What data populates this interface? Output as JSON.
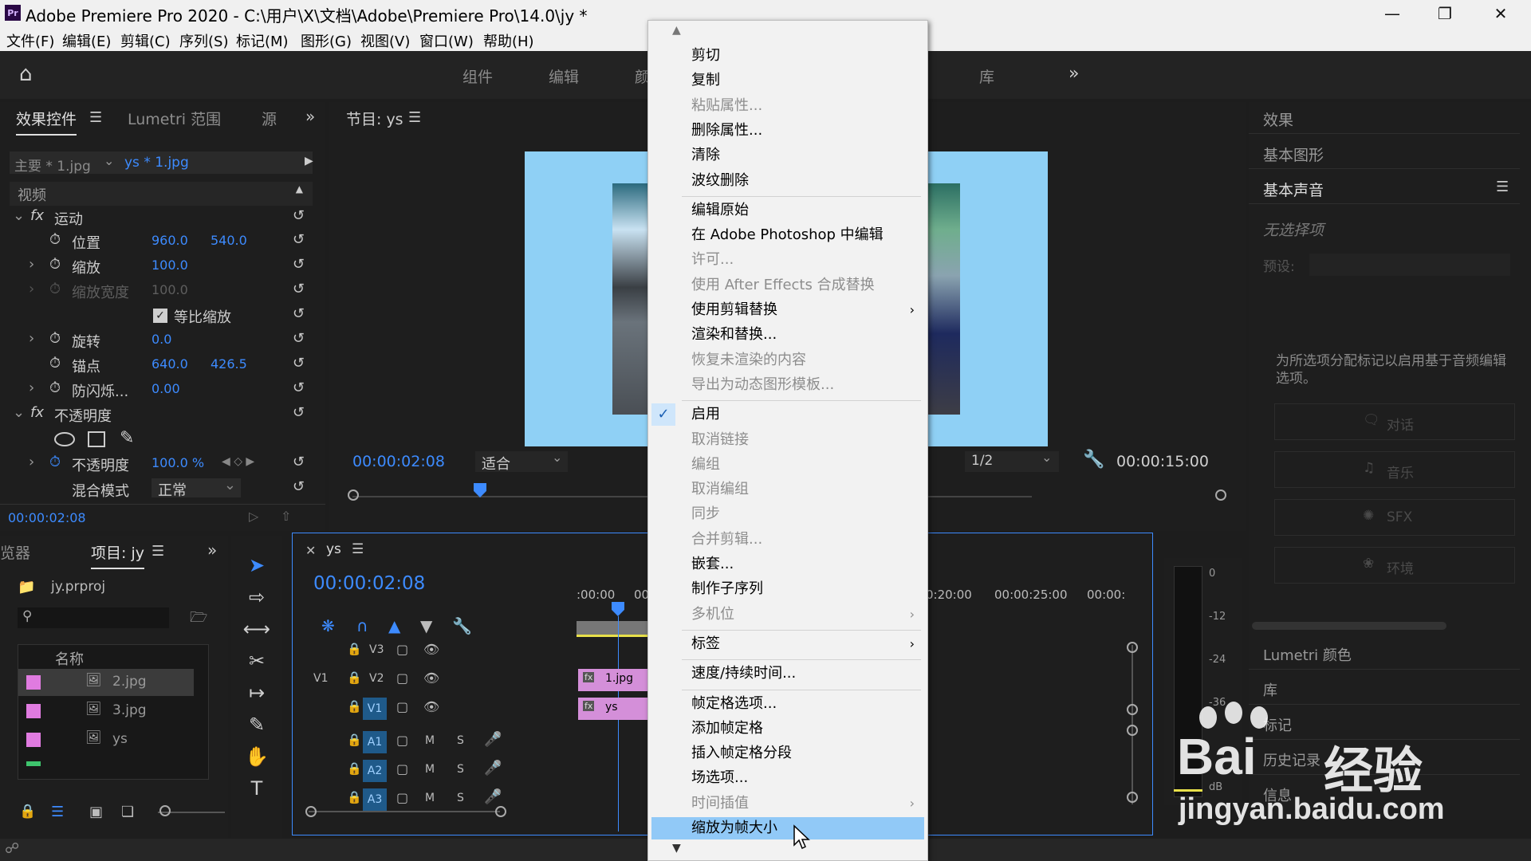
{
  "app": {
    "logo": "Pr",
    "title": "Adobe Premiere Pro 2020 - C:\\用户\\X\\文档\\Adobe\\Premiere Pro\\14.0\\jy *"
  },
  "menu": [
    "文件(F)",
    "编辑(E)",
    "剪辑(C)",
    "序列(S)",
    "标记(M)",
    "图形(G)",
    "视图(V)",
    "窗口(W)",
    "帮助(H)"
  ],
  "workspaces": [
    "组件",
    "编辑",
    "颜",
    "库"
  ],
  "effect_controls": {
    "tabs": [
      "效果控件",
      "Lumetri 范围",
      "源"
    ],
    "master": "主要 * 1.jpg",
    "clip": "ys * 1.jpg",
    "section_video": "视频",
    "motion": "运动",
    "position_label": "位置",
    "position_x": "960.0",
    "position_y": "540.0",
    "scale_label": "缩放",
    "scale_value": "100.0",
    "scale_width_label": "缩放宽度",
    "scale_width_value": "100.0",
    "uniform_scale": "等比缩放",
    "rotation_label": "旋转",
    "rotation_value": "0.0",
    "anchor_label": "锚点",
    "anchor_x": "640.0",
    "anchor_y": "426.5",
    "flicker_label": "防闪烁...",
    "flicker_value": "0.00",
    "opacity_section": "不透明度",
    "opacity_label": "不透明度",
    "opacity_value": "100.0 %",
    "blend_label": "混合模式",
    "blend_value": "正常",
    "timecode": "00:00:02:08"
  },
  "program_monitor": {
    "title": "节目: ys",
    "timecode": "00:00:02:08",
    "fit": "适合",
    "resolution": "1/2",
    "duration": "00:00:15:00"
  },
  "project": {
    "tabs": [
      "览器",
      "项目: jy"
    ],
    "file": "jy.prproj",
    "column": "名称",
    "items": [
      "2.jpg",
      "3.jpg",
      "ys"
    ]
  },
  "timeline": {
    "sequence": "ys",
    "timecode": "00:00:02:08",
    "ruler": [
      ":00:00",
      "00",
      "0:20:00",
      "00:00:25:00",
      "00:00:"
    ],
    "video_tracks": [
      "V3",
      "V2",
      "V1"
    ],
    "audio_tracks": [
      "A1",
      "A2",
      "A3"
    ],
    "source_patch": "V1",
    "clip_v2": "1.jpg",
    "clip_v1": "ys",
    "mute": "M",
    "solo": "S"
  },
  "meter": {
    "labels": [
      "0",
      "-12",
      "-24",
      "-36",
      "dB"
    ]
  },
  "right_panel": {
    "effects": "效果",
    "essential_graphics": "基本图形",
    "essential_sound": "基本声音",
    "no_selection": "无选择项",
    "preset": "预设:",
    "hint": "为所选项分配标记以启用基于音频编辑选项。",
    "buttons": [
      "对话",
      "音乐",
      "SFX",
      "环境"
    ],
    "lumetri_color": "Lumetri 颜色",
    "libraries": "库",
    "markers": "标记",
    "history": "历史记录",
    "info": "信息"
  },
  "context_menu": [
    {
      "label": "剪切",
      "disabled": false
    },
    {
      "label": "复制",
      "disabled": false
    },
    {
      "label": "粘贴属性...",
      "disabled": true
    },
    {
      "label": "删除属性...",
      "disabled": false
    },
    {
      "label": "清除",
      "disabled": false
    },
    {
      "label": "波纹删除",
      "disabled": false
    },
    {
      "label": "编辑原始",
      "disabled": false
    },
    {
      "label": "在 Adobe Photoshop 中编辑",
      "disabled": false
    },
    {
      "label": "许可...",
      "disabled": true
    },
    {
      "label": "使用 After Effects 合成替换",
      "disabled": true
    },
    {
      "label": "使用剪辑替换",
      "disabled": false,
      "submenu": true
    },
    {
      "label": "渲染和替换...",
      "disabled": false
    },
    {
      "label": "恢复未渲染的内容",
      "disabled": true
    },
    {
      "label": "导出为动态图形模板...",
      "disabled": true
    },
    {
      "label": "启用",
      "disabled": false,
      "checked": true
    },
    {
      "label": "取消链接",
      "disabled": true
    },
    {
      "label": "编组",
      "disabled": true
    },
    {
      "label": "取消编组",
      "disabled": true
    },
    {
      "label": "同步",
      "disabled": true
    },
    {
      "label": "合并剪辑...",
      "disabled": true
    },
    {
      "label": "嵌套...",
      "disabled": false
    },
    {
      "label": "制作子序列",
      "disabled": false
    },
    {
      "label": "多机位",
      "disabled": true,
      "submenu": true
    },
    {
      "label": "标签",
      "disabled": false,
      "submenu": true
    },
    {
      "label": "速度/持续时间...",
      "disabled": false
    },
    {
      "label": "帧定格选项...",
      "disabled": false
    },
    {
      "label": "添加帧定格",
      "disabled": false
    },
    {
      "label": "插入帧定格分段",
      "disabled": false
    },
    {
      "label": "场选项...",
      "disabled": false
    },
    {
      "label": "时间插值",
      "disabled": true,
      "submenu": true
    },
    {
      "label": "缩放为帧大小",
      "disabled": false,
      "highlighted": true
    }
  ],
  "watermark": {
    "brand_a": "Bai",
    "brand_b": "经验",
    "url": "jingyan.baidu.com"
  },
  "colors": {
    "accent_blue": "#3d8bff",
    "menu_highlight": "#91c9f7",
    "clip_pink": "#d48fd9",
    "preview_bg": "#8fd0f5"
  }
}
